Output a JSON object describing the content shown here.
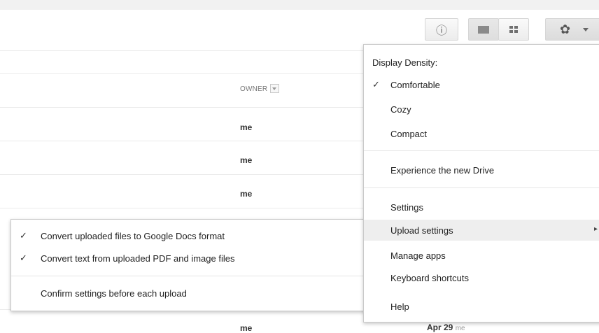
{
  "toolbar": {
    "info_icon_glyph": "ⓘ",
    "gear_icon_glyph": "✿",
    "view_mode": "list"
  },
  "table": {
    "owner_header": "OWNER",
    "rows": [
      {
        "owner": "me"
      },
      {
        "owner": "me"
      },
      {
        "owner": "me"
      },
      {
        "owner": "me",
        "date": "Apr 29",
        "by": "me"
      }
    ]
  },
  "settings_menu": {
    "density_heading": "Display Density:",
    "density_options": [
      {
        "label": "Comfortable",
        "checked": true
      },
      {
        "label": "Cozy",
        "checked": false
      },
      {
        "label": "Compact",
        "checked": false
      }
    ],
    "experience_label": "Experience the new Drive",
    "items": [
      {
        "label": "Settings"
      },
      {
        "label": "Upload settings",
        "has_submenu": true,
        "highlighted": true
      },
      {
        "label": "Manage apps"
      },
      {
        "label": "Keyboard shortcuts"
      },
      {
        "label": "Help"
      }
    ]
  },
  "upload_submenu": {
    "items": [
      {
        "label": "Convert uploaded files to Google Docs format",
        "checked": true
      },
      {
        "label": "Convert text from uploaded PDF and image files",
        "checked": true
      }
    ],
    "confirm_label": "Confirm settings before each upload"
  },
  "glyphs": {
    "check": "✓",
    "submenu_arrow": "▸"
  }
}
